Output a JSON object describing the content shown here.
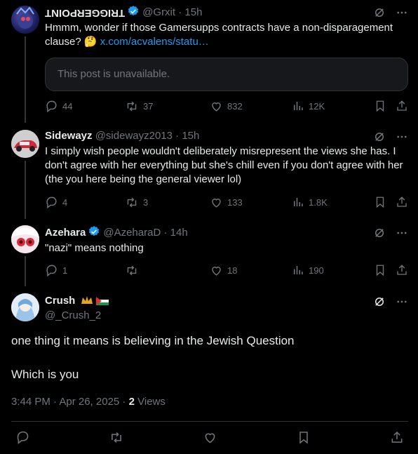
{
  "tweets": [
    {
      "name": "TRIGGERPOINT",
      "handle": "@Grxit",
      "time": "15h",
      "text": "Hmmm, wonder if those Gamersupps contracts have a non-disparagement clause? 🤔",
      "link": "x.com/acvalens/statu…",
      "quote_unavailable": "This post is unavailable.",
      "replies": "44",
      "reposts": "37",
      "likes": "832",
      "views": "12K"
    },
    {
      "name": "Sidewayz",
      "handle": "@sidewayz2013",
      "time": "15h",
      "text": "I simply wish people wouldn't deliberately misrepresent the views she has. I don't agree with her everything but she's chill even if you don't agree with her (the you here being the general viewer lol)",
      "replies": "4",
      "reposts": "3",
      "likes": "133",
      "views": "1.8K"
    },
    {
      "name": "Azehara",
      "handle": "@AzeharaD",
      "time": "14h",
      "text": "\"nazi\" means nothing",
      "replies": "1",
      "reposts": "",
      "likes": "18",
      "views": "190"
    }
  ],
  "main": {
    "name": "Crush",
    "handle": "@_Crush_2",
    "line1": "one thing it means is believing in the Jewish Question",
    "line2": "Which is you",
    "timestamp": "3:44 PM · Apr 26, 2025 ·",
    "views_count": "2",
    "views_label": "Views"
  },
  "colors": {
    "background": "#000000",
    "text": "#e7e9ea",
    "muted": "#71767b",
    "link": "#1d9bf0",
    "verified": "#1d9bf0"
  }
}
